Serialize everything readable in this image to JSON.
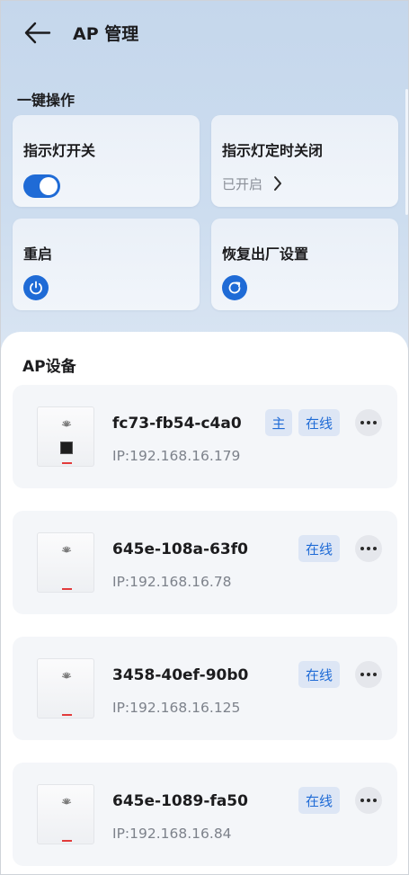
{
  "header": {
    "title": "AP 管理"
  },
  "quick_ops": {
    "section_title": "一键操作",
    "indicator_switch": {
      "label": "指示灯开关",
      "enabled": true
    },
    "indicator_timer": {
      "label": "指示灯定时关闭",
      "status": "已开启"
    },
    "reboot": {
      "label": "重启"
    },
    "factory_reset": {
      "label": "恢复出厂设置"
    }
  },
  "devices_section": {
    "title": "AP设备",
    "devices": [
      {
        "name": "fc73-fb54-c4a0",
        "ip": "IP:192.168.16.179",
        "main_badge": "主",
        "status": "在线",
        "model": "wall-plate-port"
      },
      {
        "name": "645e-108a-63f0",
        "ip": "IP:192.168.16.78",
        "status": "在线",
        "model": "ceiling"
      },
      {
        "name": "3458-40ef-90b0",
        "ip": "IP:192.168.16.125",
        "status": "在线",
        "model": "ceiling"
      },
      {
        "name": "645e-1089-fa50",
        "ip": "IP:192.168.16.84",
        "status": "在线",
        "model": "ceiling"
      }
    ]
  },
  "colors": {
    "accent": "#1f6bd6",
    "badge_bg": "#dde6f5",
    "led": "#e23b3b"
  },
  "icons": {
    "back": "arrow-left-icon",
    "chevron": "chevron-right-icon",
    "power": "power-icon",
    "reset": "refresh-icon",
    "more": "more-icon",
    "brand": "huawei-logo-icon"
  }
}
